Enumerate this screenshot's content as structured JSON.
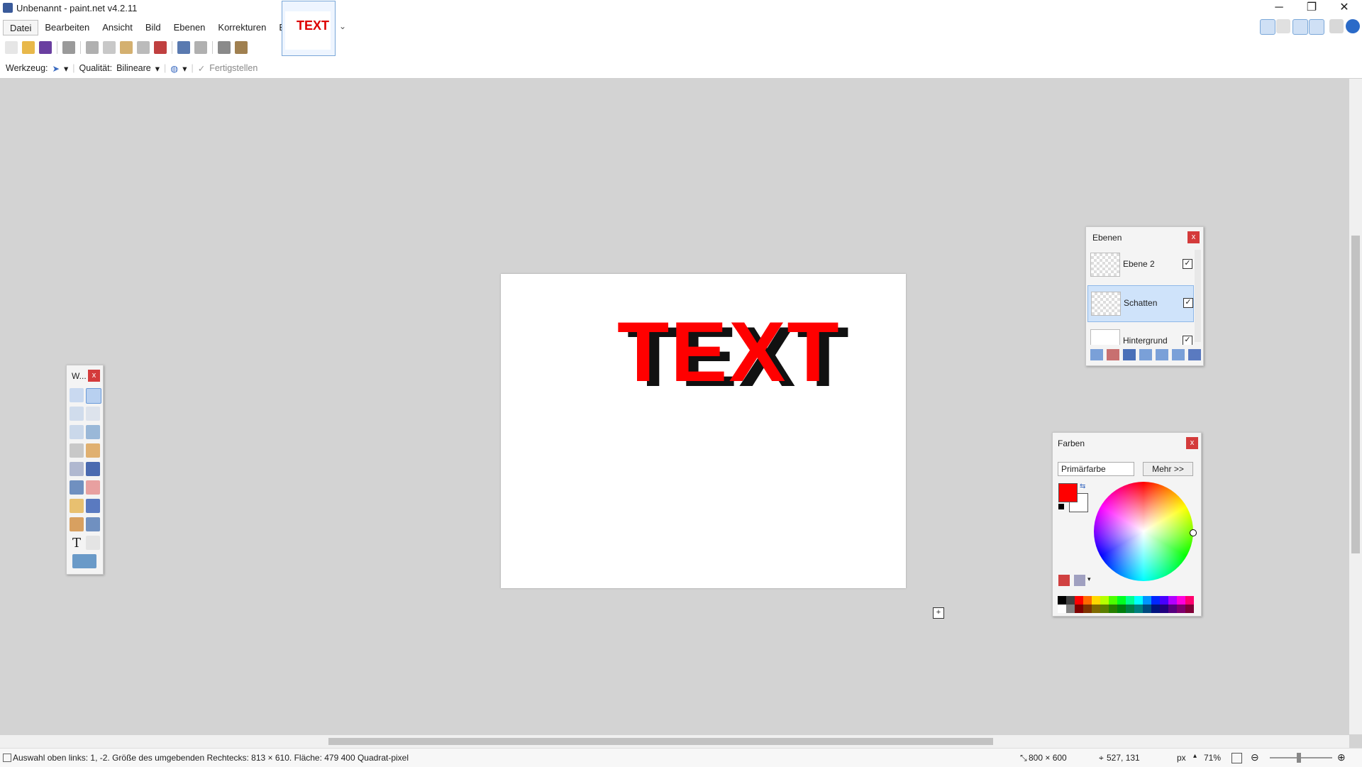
{
  "window": {
    "title": "Unbenannt - paint.net v4.2.11",
    "min_glyph": "─",
    "restore_glyph": "❐",
    "close_glyph": "✕"
  },
  "menu": [
    "Datei",
    "Bearbeiten",
    "Ansicht",
    "Bild",
    "Ebenen",
    "Korrekturen",
    "Effekte"
  ],
  "tab": {
    "thumb_text": "TEXT",
    "more_glyph": "⌄"
  },
  "toolbar_icons": [
    "new-icon",
    "open-icon",
    "save-icon",
    "print-icon",
    "cut-icon",
    "copy-icon",
    "paste-icon",
    "crop-icon",
    "delete-icon",
    "undo-icon",
    "redo-icon",
    "grid-icon",
    "ruler-icon"
  ],
  "options": {
    "tool_label": "Werkzeug:",
    "quality_label": "Qualität:",
    "quality_value": "Bilineare",
    "finish_label": "Fertigstellen",
    "dropdown_glyph": "▾",
    "check_glyph": "✓"
  },
  "canvas": {
    "text": "TEXT"
  },
  "tools_window": {
    "title": "W...",
    "close": "x"
  },
  "layers_window": {
    "title": "Ebenen",
    "close": "x",
    "layers": [
      {
        "name": "Ebene 2",
        "visible": "✓"
      },
      {
        "name": "Schatten",
        "visible": "✓"
      },
      {
        "name": "Hintergrund",
        "visible": "✓"
      }
    ]
  },
  "colors_window": {
    "title": "Farben",
    "close": "x",
    "mode": "Primärfarbe",
    "more": "Mehr >>",
    "primary": "#ff0000",
    "secondary": "#ffffff",
    "palette": [
      "#000000",
      "#404040",
      "#ff0000",
      "#ff6a00",
      "#ffd800",
      "#b6ff00",
      "#4cff00",
      "#00ff21",
      "#00ff90",
      "#00ffff",
      "#0094ff",
      "#0026ff",
      "#4800ff",
      "#b200ff",
      "#ff00dc",
      "#ff006e",
      "#ffffff",
      "#808080",
      "#7f0000",
      "#7f3300",
      "#7f6a00",
      "#5b7f00",
      "#267f00",
      "#007f0e",
      "#007f46",
      "#007f7f",
      "#004a7f",
      "#00137f",
      "#21007f",
      "#57007f",
      "#7f006e",
      "#7f0037"
    ]
  },
  "status": {
    "selection": "Auswahl oben links: 1, -2. Größe des umgebenden Rechtecks: 813 × 610. Fläche: 479 400 Quadrat-pixel",
    "image_size": "800 × 600",
    "cursor": "527, 131",
    "units": "px",
    "zoom": "71%"
  }
}
